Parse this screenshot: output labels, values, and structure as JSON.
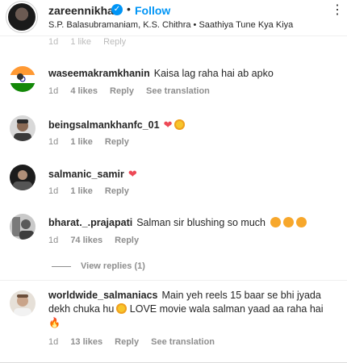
{
  "header": {
    "username": "zareennikhat",
    "follow_label": "Follow",
    "separator": "•",
    "subtitle": "S.P. Balasubramaniam, K.S. Chithra • Saathiya Tune Kya Kiya"
  },
  "peek": {
    "time": "1d",
    "likes": "1 like",
    "reply": "Reply"
  },
  "comments": [
    {
      "username": "waseemakramkhanin",
      "text": "Kaisa lag raha hai ab apko",
      "time": "1d",
      "likes": "4 likes",
      "reply": "Reply",
      "translate": "See translation"
    },
    {
      "username": "beingsalmankhanfc_01",
      "text": "",
      "time": "1d",
      "likes": "1 like",
      "reply": "Reply"
    },
    {
      "username": "salmanic_samir",
      "text": "",
      "time": "1d",
      "likes": "1 like",
      "reply": "Reply"
    },
    {
      "username": "bharat._.prajapati",
      "text": "Salman sir blushing so much",
      "time": "1d",
      "likes": "74 likes",
      "reply": "Reply"
    },
    {
      "username": "worldwide_salmaniacs",
      "text": "Main yeh reels 15 baar se bhi jyada dekh chuka hu",
      "text2": "LOVE movie wala salman yaad aa raha hai",
      "time": "1d",
      "likes": "13 likes",
      "reply": "Reply",
      "translate": "See translation"
    }
  ],
  "view_replies": "View replies (1)",
  "icons": {
    "heart": "❤",
    "fire": "🔥",
    "more": "⋮",
    "check": "✓"
  },
  "colors": {
    "link": "#0095f6",
    "heart": "#ed4956",
    "muted": "#8e8e8e"
  }
}
